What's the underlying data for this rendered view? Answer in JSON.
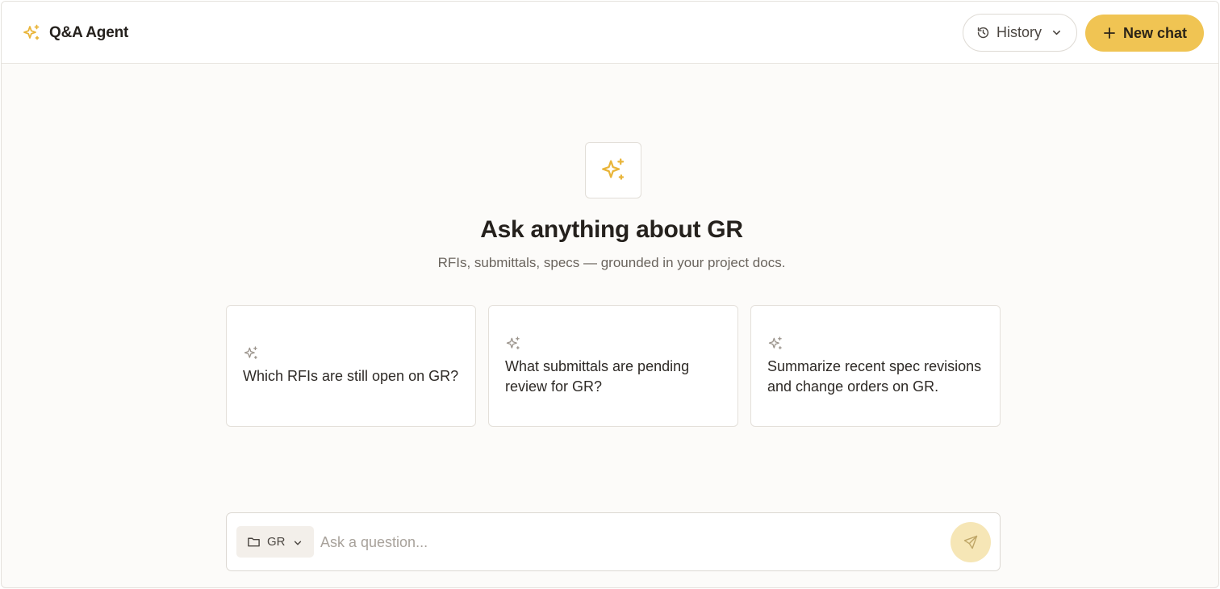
{
  "header": {
    "title": "Q&A Agent",
    "brand_icon": "sparkles-icon",
    "history_label": "History",
    "new_chat_label": "New chat"
  },
  "hero": {
    "icon": "sparkles-icon",
    "title": "Ask anything about GR",
    "subtitle": "RFIs, submittals, specs — grounded in your project docs."
  },
  "suggestions": [
    {
      "text": "Which RFIs are still open on GR?"
    },
    {
      "text": "What submittals are pending review for GR?"
    },
    {
      "text": "Summarize recent spec revisions and change orders on GR."
    }
  ],
  "composer": {
    "scope_label": "GR",
    "input_value": "",
    "input_placeholder": "Ask a question..."
  },
  "colors": {
    "accent": "#f0c453",
    "accent_soft": "#f6e6b6",
    "background": "#fcfbf9",
    "border": "#e4e0da",
    "text": "#25211d"
  }
}
